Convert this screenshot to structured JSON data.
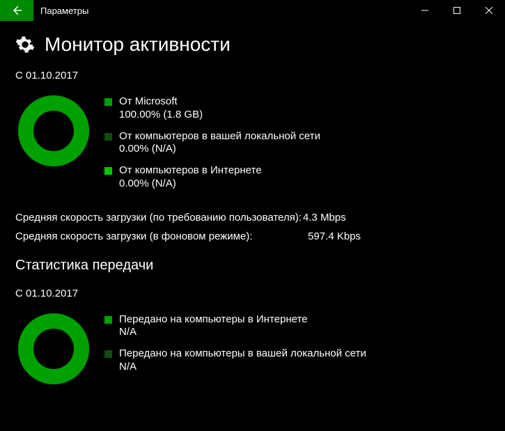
{
  "window": {
    "title": "Параметры"
  },
  "page": {
    "heading": "Монитор активности"
  },
  "download": {
    "since": "С 01.10.2017",
    "legend": {
      "microsoft": {
        "label": "От Microsoft",
        "value": "100.00%  (1.8 GB)"
      },
      "local": {
        "label": "От компьютеров в вашей локальной сети",
        "value": "0.00%  (N/A)"
      },
      "internet": {
        "label": "От компьютеров в Интернете",
        "value": "0.00%  (N/A)"
      }
    }
  },
  "speeds": {
    "foreground": {
      "label": "Средняя скорость загрузки (по требованию пользователя):",
      "value": "4.3 Mbps"
    },
    "background": {
      "label": "Средняя скорость загрузки (в фоновом режиме):",
      "value": "597.4 Kbps"
    }
  },
  "upload": {
    "heading": "Статистика передачи",
    "since": "С 01.10.2017",
    "legend": {
      "internet": {
        "label": "Передано на компьютеры в Интернете",
        "value": "N/A"
      },
      "local": {
        "label": "Передано на компьютеры в вашей локальной сети",
        "value": "N/A"
      }
    }
  },
  "chart_data": [
    {
      "type": "pie",
      "title": "Download sources",
      "categories": [
        "От Microsoft",
        "От компьютеров в вашей локальной сети",
        "От компьютеров в Интернете"
      ],
      "values": [
        100.0,
        0.0,
        0.0
      ],
      "colors": [
        "#00a000",
        "#0f4d0f",
        "#00c800"
      ]
    },
    {
      "type": "pie",
      "title": "Upload targets",
      "categories": [
        "Передано на компьютеры в Интернете",
        "Передано на компьютеры в вашей локальной сети"
      ],
      "values": [
        0,
        0
      ],
      "colors": [
        "#00a000",
        "#0f4d0f"
      ]
    }
  ]
}
